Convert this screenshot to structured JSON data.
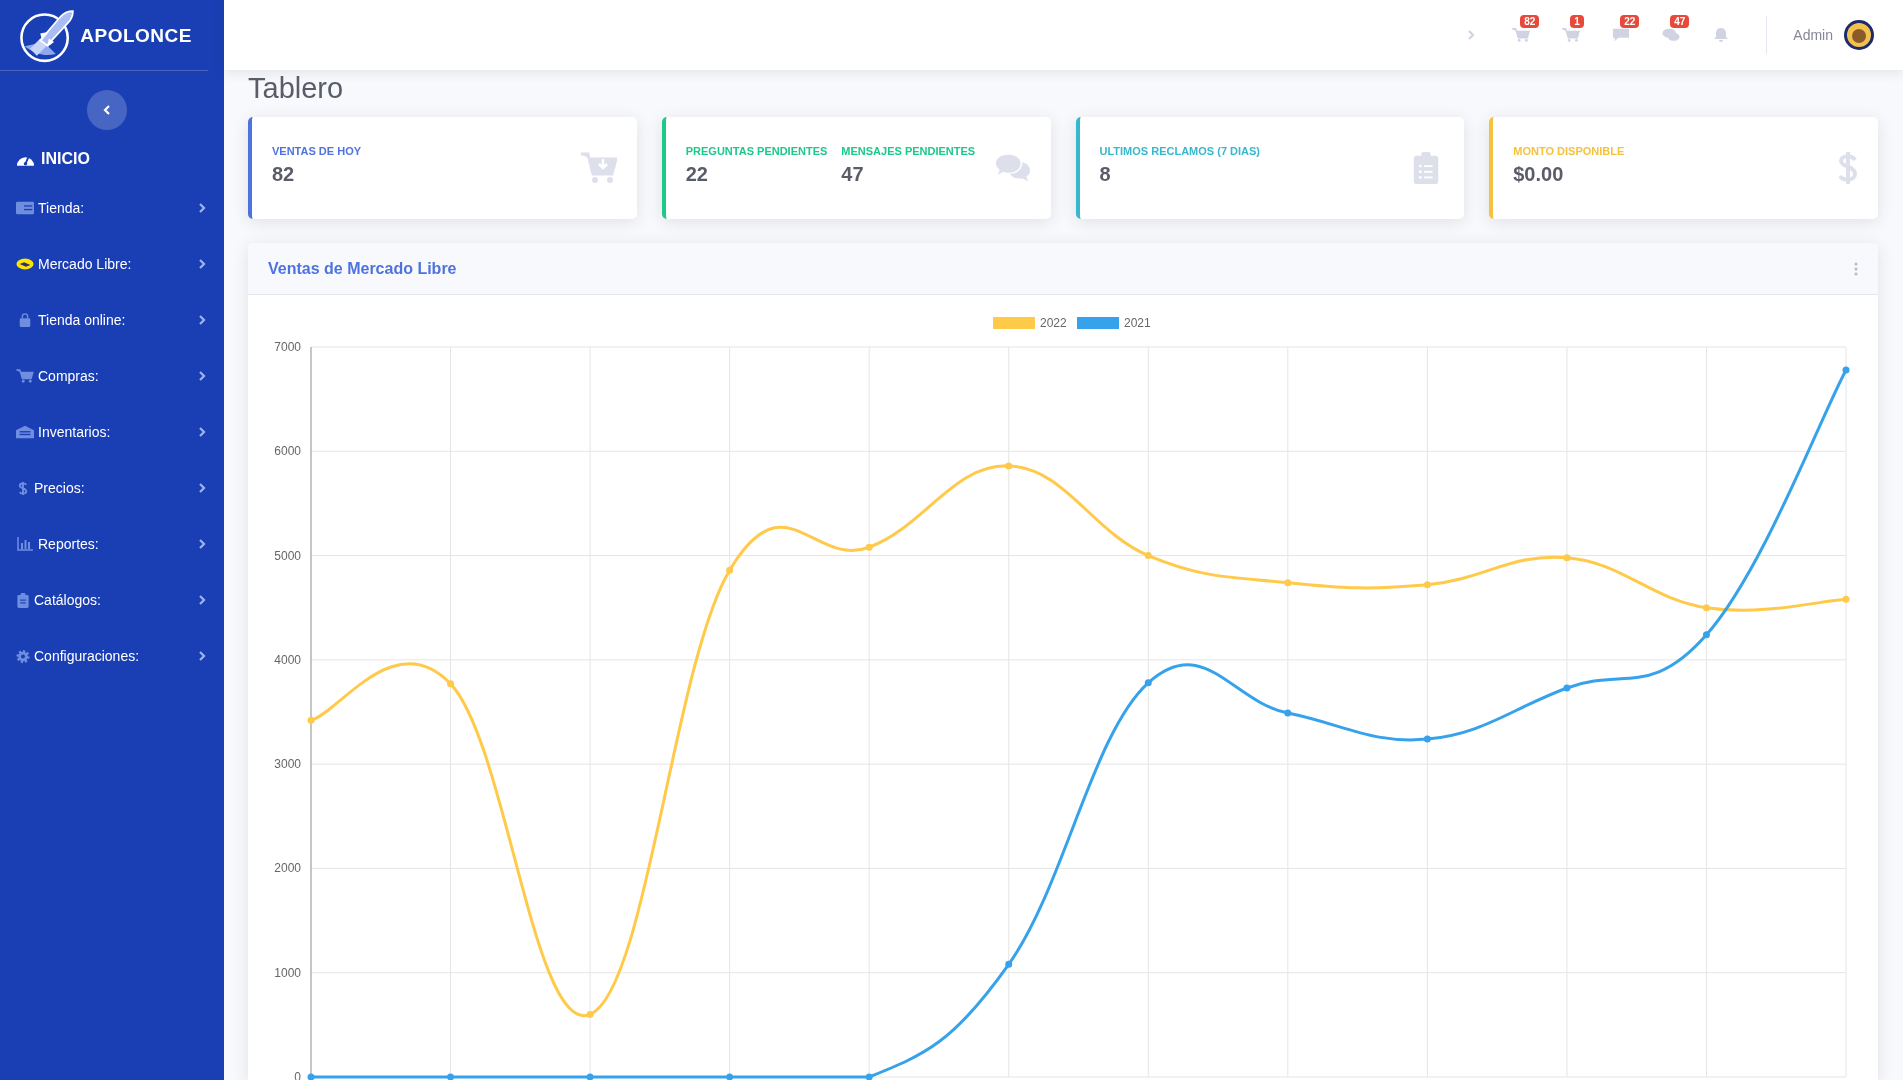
{
  "sidebar": {
    "brand": "APOLONCE",
    "home": "INICIO",
    "items": [
      {
        "label": "Tienda:",
        "kind": "card"
      },
      {
        "label": "Mercado Libre:",
        "kind": "handshake"
      },
      {
        "label": "Tienda online:",
        "kind": "bag"
      },
      {
        "label": "Compras:",
        "kind": "cart"
      },
      {
        "label": "Inventarios:",
        "kind": "warehouse"
      },
      {
        "label": "Precios:",
        "kind": "dollar"
      },
      {
        "label": "Reportes:",
        "kind": "chart"
      },
      {
        "label": "Catálogos:",
        "kind": "clipboard"
      },
      {
        "label": "Configuraciones:",
        "kind": "gear"
      }
    ]
  },
  "topbar": {
    "notifications": [
      {
        "kind": "cart",
        "badge": "82"
      },
      {
        "kind": "cart",
        "badge": "1"
      },
      {
        "kind": "comment",
        "badge": "22"
      },
      {
        "kind": "comments",
        "badge": "47"
      },
      {
        "kind": "bell"
      }
    ],
    "user": "Admin"
  },
  "page_title": "Tablero",
  "cards": [
    {
      "color": "#4e73df",
      "kind": "cart",
      "stats": [
        {
          "label": "VENTAS DE HOY",
          "value": "82"
        }
      ]
    },
    {
      "color": "#1cc88a",
      "kind": "comments",
      "stats": [
        {
          "label": "PREGUNTAS PENDIENTES",
          "value": "22"
        },
        {
          "label": "MENSAJES PENDIENTES",
          "value": "47"
        }
      ]
    },
    {
      "color": "#36b9cc",
      "kind": "clipboard",
      "stats": [
        {
          "label": "ULTIMOS RECLAMOS (7 DIAS)",
          "value": "8"
        }
      ]
    },
    {
      "color": "#f6c23e",
      "kind": "dollar",
      "stats": [
        {
          "label": "MONTO DISPONIBLE",
          "value": "$0.00"
        }
      ]
    }
  ],
  "chart_panel": {
    "title": "Ventas de Mercado Libre",
    "chart_data": {
      "type": "line",
      "grid": true,
      "legend": true,
      "ylim": [
        0,
        7000
      ],
      "yticks": [
        0,
        1000,
        2000,
        3000,
        4000,
        5000,
        6000,
        7000
      ],
      "series": [
        {
          "name": "2022",
          "color": "#ffc94a",
          "marker": "circle",
          "values": [
            3420,
            3770,
            600,
            4860,
            5080,
            5860,
            5000,
            4740,
            4720,
            4980,
            4500,
            4580
          ]
        },
        {
          "name": "2021",
          "color": "#36a2eb",
          "marker": "circle",
          "values": [
            0,
            0,
            0,
            0,
            0,
            1080,
            3780,
            3490,
            3240,
            3730,
            4240,
            6780
          ]
        }
      ]
    }
  }
}
